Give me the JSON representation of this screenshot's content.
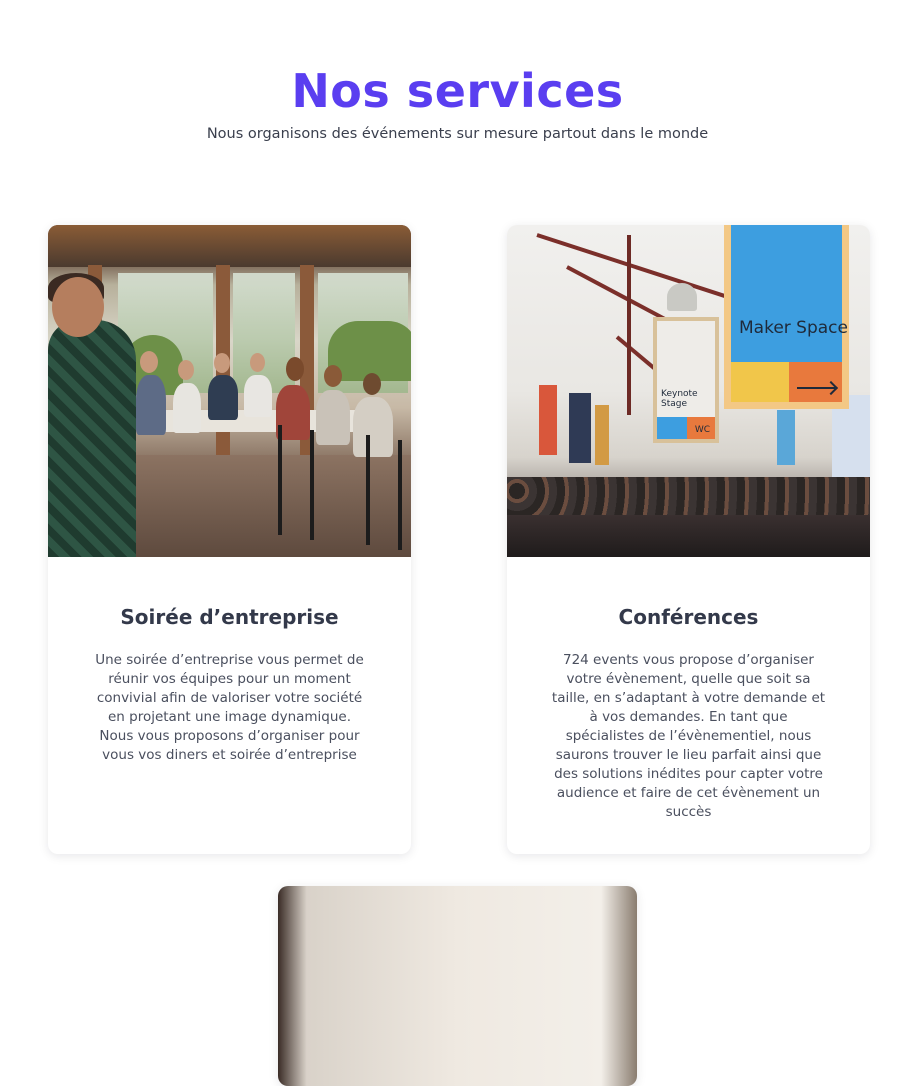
{
  "header": {
    "title": "Nos services",
    "subtitle": "Nous organisons des événements sur mesure partout dans le monde"
  },
  "services": [
    {
      "title": "Soirée d’entreprise",
      "text": "Une soirée d’entreprise vous permet de réunir vos équipes pour un moment convivial afin de valoriser votre société en projetant une image dynamique. Nous vous proposons d’organiser pour vous vos diners et soirée d’entreprise"
    },
    {
      "title": "Conférences",
      "text": "724 events vous propose d’organiser votre évènement, quelle que soit sa taille, en s’adaptant à votre demande et à vos demandes. En tant que spécialistes de l’évènementiel, nous saurons trouver le lieu parfait ainsi que des solutions inédites pour capter votre audience et faire de cet évènement un succès",
      "photo_sign_main": "Maker Space",
      "photo_sign_small": "Keynote Stage",
      "photo_sign_wc": "WC"
    }
  ],
  "colors": {
    "accent": "#5a3ef0",
    "text": "#363b4d",
    "card_bg": "#ffffff"
  }
}
